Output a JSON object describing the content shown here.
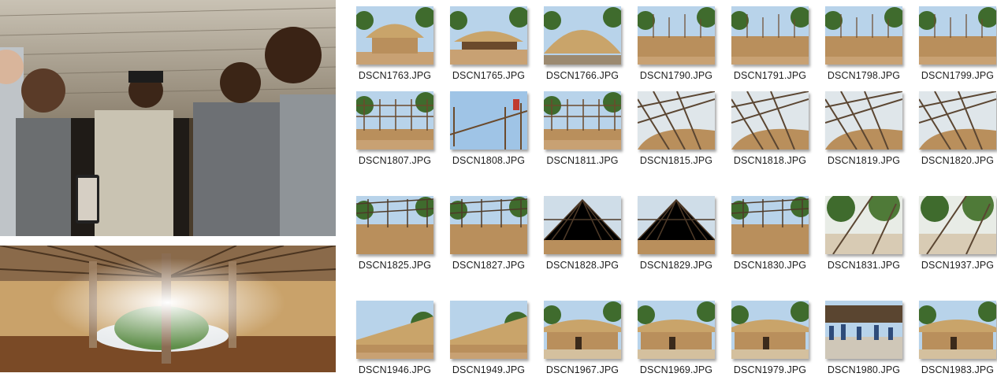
{
  "files": [
    {
      "name": "DSCN1763.JPG",
      "scene": "hut-thatch"
    },
    {
      "name": "DSCN1765.JPG",
      "scene": "hut-thatch-low"
    },
    {
      "name": "DSCN1766.JPG",
      "scene": "hut-thatch-big"
    },
    {
      "name": "DSCN1790.JPG",
      "scene": "wall-build"
    },
    {
      "name": "DSCN1791.JPG",
      "scene": "wall-build"
    },
    {
      "name": "DSCN1798.JPG",
      "scene": "wall-build"
    },
    {
      "name": "DSCN1799.JPG",
      "scene": "wall-build"
    },
    {
      "name": "DSCN1807.JPG",
      "scene": "scaffold"
    },
    {
      "name": "DSCN1808.JPG",
      "scene": "scaffold-sky"
    },
    {
      "name": "DSCN1811.JPG",
      "scene": "scaffold"
    },
    {
      "name": "DSCN1815.JPG",
      "scene": "roof-frame"
    },
    {
      "name": "DSCN1818.JPG",
      "scene": "roof-frame"
    },
    {
      "name": "DSCN1819.JPG",
      "scene": "roof-frame"
    },
    {
      "name": "DSCN1820.JPG",
      "scene": "roof-frame"
    },
    {
      "name": "DSCN1825.JPG",
      "scene": "roof-frame-wall"
    },
    {
      "name": "DSCN1827.JPG",
      "scene": "roof-frame-wall"
    },
    {
      "name": "DSCN1828.JPG",
      "scene": "roof-frame-sky"
    },
    {
      "name": "DSCN1829.JPG",
      "scene": "roof-frame-sky"
    },
    {
      "name": "DSCN1830.JPG",
      "scene": "roof-frame-wall"
    },
    {
      "name": "DSCN1831.JPG",
      "scene": "trees-yard"
    },
    {
      "name": "DSCN1937.JPG",
      "scene": "trees-yard"
    },
    {
      "name": "DSCN1946.JPG",
      "scene": "thatch-roof"
    },
    {
      "name": "DSCN1949.JPG",
      "scene": "thatch-roof"
    },
    {
      "name": "DSCN1967.JPG",
      "scene": "finished-hut"
    },
    {
      "name": "DSCN1969.JPG",
      "scene": "finished-hut"
    },
    {
      "name": "DSCN1979.JPG",
      "scene": "finished-hut"
    },
    {
      "name": "DSCN1980.JPG",
      "scene": "crowd"
    },
    {
      "name": "DSCN1983.JPG",
      "scene": "finished-hut"
    }
  ],
  "colors": {
    "sky": "#b8d3ea",
    "earth": "#c8a173",
    "wall": "#b98f5c",
    "thatch": "#c9a46a",
    "wood": "#6b4a2c",
    "foliage": "#3f6b2d"
  }
}
